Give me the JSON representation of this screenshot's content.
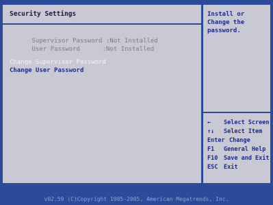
{
  "main": {
    "title": "Security Settings",
    "rows": [
      {
        "label": "Supervisor Password",
        "value": ":Not Installed"
      },
      {
        "label": "User Password",
        "value": ":Not Installed"
      }
    ],
    "actions": [
      {
        "label": "Change Supervisor Password"
      },
      {
        "label": "Change User Password"
      }
    ]
  },
  "help": {
    "text": "Install or Change the password."
  },
  "keys": [
    {
      "key": "←",
      "action": "Select Screen"
    },
    {
      "key": "↑↓",
      "action": "Select Item"
    },
    {
      "key": "Enter",
      "action": "Change"
    },
    {
      "key": "F1",
      "action": "General Help"
    },
    {
      "key": "F10",
      "action": "Save and Exit"
    },
    {
      "key": "ESC",
      "action": "Exit"
    }
  ],
  "footer": {
    "copyright": "v02.59 (C)Copyright 1985-2005, American Megatrends, Inc."
  }
}
